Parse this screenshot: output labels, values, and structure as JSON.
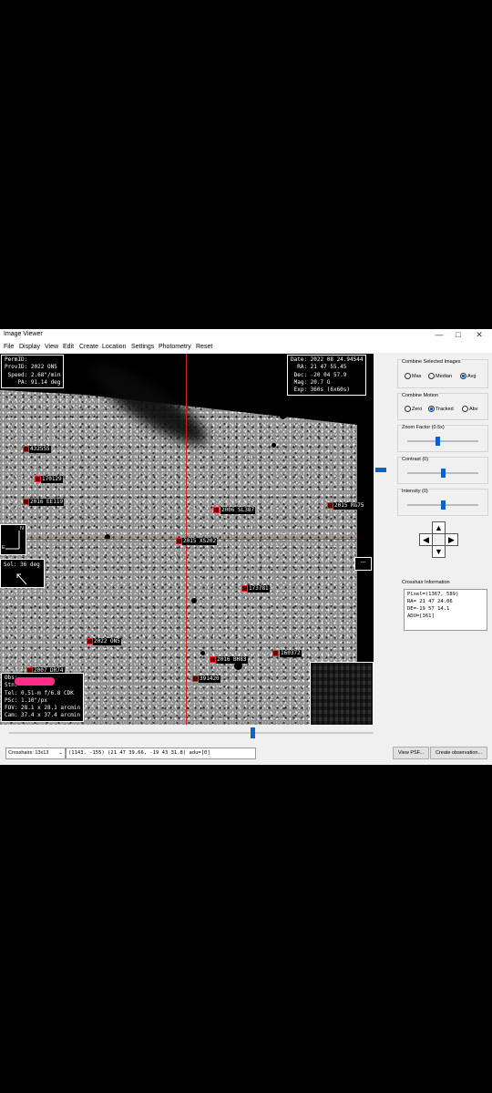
{
  "window": {
    "title": "Image Viewer",
    "minimize": "—",
    "maximize": "□",
    "close": "✕"
  },
  "menu": [
    "File",
    "Display",
    "View",
    "Edit",
    "Create",
    "Location",
    "Settings",
    "Photometry",
    "Reset"
  ],
  "info_topleft": "PermID:\nProvID: 2022 ON5\n Speed: 2.68\"/min\n    PA: 91.14 deg",
  "info_topright": "Date: 2022 08 24.94544\n  RA: 21 47 55.45\n Dec: -20 04 57.9\n Mag: 20.7 G\n Exp: 360s (6x60s)",
  "info_bottomleft": "Obs:\nStn:\nTel: 0.51-m f/6.8 CDK\nPSc: 1.10\"/px\nFOV: 28.1 x 28.1 arcmin\nCam: 37.4 x 37.4 arcmin",
  "compass": {
    "north": "N",
    "east": "E"
  },
  "sol": "Sol: 36 deg",
  "expand_button": "---",
  "objects": {
    "o1": "432555",
    "o2": "170129",
    "o3": "2016 EE119",
    "o4": "2006 SL387",
    "o5": "2015 RG75",
    "o6": "2015 XS202",
    "o7": "173781",
    "o8": "2022 ON5",
    "o9": "160372",
    "o10": "2016 BH83",
    "o11": "391420",
    "o12": "2007 DR74"
  },
  "panel": {
    "combine_images": {
      "title": "Combine Selected Images",
      "options": [
        "Max",
        "Median",
        "Avg"
      ],
      "selected": "Avg"
    },
    "combine_motion": {
      "title": "Combine Motion",
      "options": [
        "Zero",
        "Tracked",
        "Abv"
      ],
      "selected": "Tracked"
    },
    "zoom": {
      "label": "Zoom Factor (0.5x)",
      "level": 0.42
    },
    "contrast": {
      "label": "Contrast (0)",
      "level": 0.5
    },
    "intensity": {
      "label": "Intensity (0)",
      "level": 0.5
    },
    "arrows": {
      "up": "▲",
      "down": "▼",
      "left": "◀",
      "right": "▶"
    },
    "crosshair_info_title": "Crosshair Information",
    "crosshair_info": "Pixel=(1367, 589)\nRA= 21 47 24.06\nDE=-19 57 14.1\nADU=[361]"
  },
  "status": {
    "crosshairs": "Crosshairs: 13x13",
    "readout": "(1143, -155) (21 47 39.66, -19 43 31.8) adu=[0]",
    "view_psf": "View PSF...",
    "create_obs": "Create observation..."
  }
}
